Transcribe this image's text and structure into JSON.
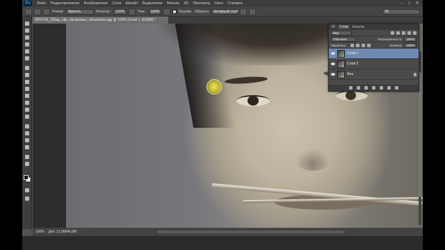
{
  "app": {
    "logo": "Ps"
  },
  "menu": [
    "Файл",
    "Редактирование",
    "Изображение",
    "Слои",
    "Шрифт",
    "Выделение",
    "Фильтр",
    "3D",
    "Просмотр",
    "Окно",
    "Справка"
  ],
  "window_controls": [
    "–",
    "□",
    "✕"
  ],
  "options": {
    "mode_label": "Режим:",
    "mode_value": "Яркость",
    "opacity_label": "Непрозр.:",
    "opacity_value": "100%",
    "flow_label": "Наж.:",
    "flow_value": "100%",
    "sample_label": "Выравн.",
    "sample_layer_label": "Образец:",
    "sample_layer_value": "Активный слой",
    "workspace": "3D"
  },
  "document": {
    "tab_title": "3976742_925ap_otlp_obrabotano_obrabotano.jpg @ 100% (Слой 1, RGB/8) *",
    "status_zoom": "100%",
    "status_doc": "Док: 12,9M/46,6M"
  },
  "layers_panel": {
    "tabs": [
      "3D",
      "Слои",
      "Каналы"
    ],
    "filter_label": "Вид",
    "blend_mode": "Обычные",
    "opacity_label": "Непрозрачность:",
    "opacity_value": "100%",
    "lock_label": "Закрепить:",
    "fill_label": "Заливка:",
    "fill_value": "100%",
    "layers": [
      {
        "name": "Слой 1",
        "active": true
      },
      {
        "name": "Слой 2",
        "active": false
      },
      {
        "name": "Фон",
        "active": false,
        "locked": true
      }
    ]
  },
  "colors": {
    "selected_layer": "#6f89b0",
    "brush_cursor": "#e9e26a"
  }
}
